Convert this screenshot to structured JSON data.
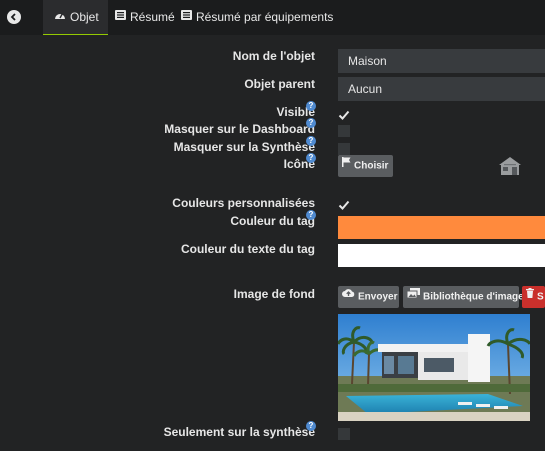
{
  "tabs": {
    "objet": "Objet",
    "resume": "Résumé",
    "resume_equipements": "Résumé par équipements"
  },
  "form": {
    "nom_label": "Nom de l'objet",
    "nom_value": "Maison",
    "parent_label": "Objet parent",
    "parent_value": "Aucun",
    "visible_label": "Visible",
    "masquer_dashboard_label": "Masquer sur le Dashboard",
    "masquer_synthese_label": "Masquer sur la Synthèse",
    "icone_label": "Icône",
    "choisir_button": "Choisir",
    "couleurs_label": "Couleurs personnalisées",
    "couleur_tag_label": "Couleur du tag",
    "couleur_texte_tag_label": "Couleur du texte du tag",
    "image_fond_label": "Image de fond",
    "envoyer_button": "Envoyer",
    "bibliotheque_button": "Bibliothèque d'image",
    "supprimer_button_partial": "S",
    "seulement_synthese_label": "Seulement sur la synthèse"
  },
  "help_glyph": "?",
  "colors": {
    "tag_color": "#ff8a3d",
    "tag_text_color": "#ffffff",
    "active_tab_underline": "#94ca02",
    "delete_button": "#c9302c"
  }
}
